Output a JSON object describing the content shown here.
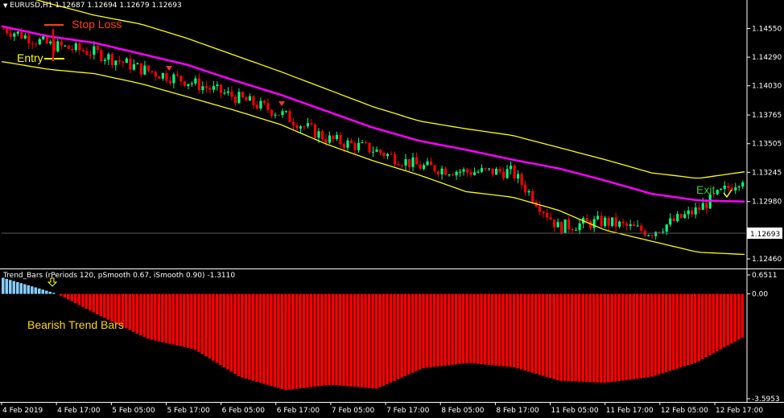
{
  "header": {
    "symbol_line": "EURUSD,H1  1.12687 1.12694 1.12679 1.12693",
    "indicator_line": "Trend_Bars  (rPeriods 120, pSmooth 0.67, iSmooth 0.90)  -1.3110"
  },
  "annotations": {
    "stop_loss": "Stop Loss",
    "entry": "Entry",
    "exit": "Exit",
    "bearish": "Bearish Trend Bars"
  },
  "price_axis": {
    "ticks": [
      "1.14550",
      "1.14290",
      "1.14030",
      "1.13765",
      "1.13505",
      "1.13245",
      "1.12980",
      "1.12460"
    ],
    "current_price": "1.12693"
  },
  "indicator_axis": {
    "ticks": [
      "0.6511",
      "0.00",
      "-3.5953"
    ]
  },
  "time_axis": {
    "ticks": [
      "4 Feb 2019",
      "4 Feb 17:00",
      "5 Feb 05:00",
      "5 Feb 17:00",
      "6 Feb 05:00",
      "6 Feb 17:00",
      "7 Feb 05:00",
      "7 Feb 17:00",
      "8 Feb 05:00",
      "8 Feb 17:00",
      "11 Feb 05:00",
      "11 Feb 17:00",
      "12 Feb 05:00",
      "12 Feb 17:00"
    ]
  },
  "colors": {
    "background": "#000000",
    "bull_candle": "#00ff7f",
    "bear_candle": "#ff0000",
    "ma_line": "#ff00ff",
    "band_line": "#ffff00",
    "histogram_bear": "#ff0000",
    "histogram_bull": "#87cefa",
    "stop_loss_text": "#ff4500",
    "entry_text": "#ffff00",
    "exit_text": "#32cd32",
    "bearish_text": "#ffd700"
  },
  "chart_data": [
    {
      "type": "candlestick",
      "title": "EURUSD,H1",
      "ylim": [
        1.1238,
        1.1475
      ],
      "magenta_line": [
        1.1457,
        1.1448,
        1.1442,
        1.1432,
        1.1422,
        1.1408,
        1.1395,
        1.138,
        1.1365,
        1.1353,
        1.1345,
        1.1336,
        1.1328,
        1.1317,
        1.1305,
        1.1299,
        1.1298
      ],
      "upper_band": [
        1.149,
        1.1478,
        1.1467,
        1.1459,
        1.1446,
        1.1431,
        1.1416,
        1.14,
        1.1384,
        1.1371,
        1.1364,
        1.1358,
        1.1347,
        1.1336,
        1.1324,
        1.1319,
        1.1325
      ],
      "lower_band": [
        1.1425,
        1.1418,
        1.1414,
        1.1405,
        1.1393,
        1.1381,
        1.1368,
        1.135,
        1.1335,
        1.1322,
        1.1307,
        1.1302,
        1.129,
        1.1272,
        1.1262,
        1.1252,
        1.125
      ],
      "close_path": [
        1.1455,
        1.144,
        1.1433,
        1.1418,
        1.1407,
        1.1393,
        1.1378,
        1.1355,
        1.1345,
        1.133,
        1.1325,
        1.1325,
        1.1275,
        1.128,
        1.127,
        1.129,
        1.132
      ],
      "current_price": 1.12693
    },
    {
      "type": "bar",
      "title": "Trend_Bars",
      "ylim": [
        -3.5953,
        0.6511
      ],
      "bull_count": 15,
      "bear_count": 190,
      "bear_profile": [
        0.0,
        -0.8,
        -1.55,
        -1.9,
        -2.85,
        -3.3,
        -3.12,
        -3.25,
        -2.55,
        -2.37,
        -2.52,
        -2.98,
        -3.05,
        -2.85,
        -2.35,
        -1.5
      ],
      "last_value": -1.311
    }
  ]
}
